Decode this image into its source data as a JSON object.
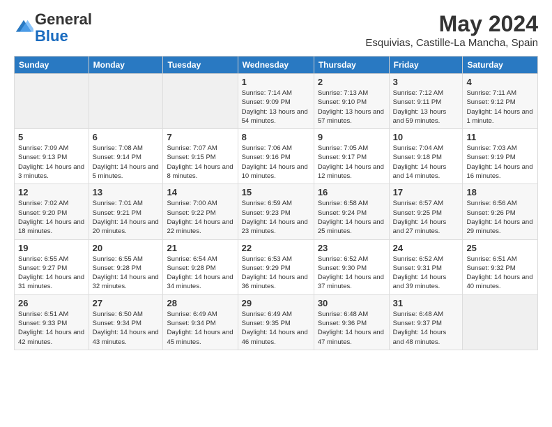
{
  "header": {
    "logo_general": "General",
    "logo_blue": "Blue",
    "title": "May 2024",
    "subtitle": "Esquivias, Castille-La Mancha, Spain"
  },
  "days_of_week": [
    "Sunday",
    "Monday",
    "Tuesday",
    "Wednesday",
    "Thursday",
    "Friday",
    "Saturday"
  ],
  "weeks": [
    [
      {
        "day": "",
        "sunrise": "",
        "sunset": "",
        "daylight": "",
        "empty": true
      },
      {
        "day": "",
        "sunrise": "",
        "sunset": "",
        "daylight": "",
        "empty": true
      },
      {
        "day": "",
        "sunrise": "",
        "sunset": "",
        "daylight": "",
        "empty": true
      },
      {
        "day": "1",
        "sunrise": "Sunrise: 7:14 AM",
        "sunset": "Sunset: 9:09 PM",
        "daylight": "Daylight: 13 hours and 54 minutes."
      },
      {
        "day": "2",
        "sunrise": "Sunrise: 7:13 AM",
        "sunset": "Sunset: 9:10 PM",
        "daylight": "Daylight: 13 hours and 57 minutes."
      },
      {
        "day": "3",
        "sunrise": "Sunrise: 7:12 AM",
        "sunset": "Sunset: 9:11 PM",
        "daylight": "Daylight: 13 hours and 59 minutes."
      },
      {
        "day": "4",
        "sunrise": "Sunrise: 7:11 AM",
        "sunset": "Sunset: 9:12 PM",
        "daylight": "Daylight: 14 hours and 1 minute."
      }
    ],
    [
      {
        "day": "5",
        "sunrise": "Sunrise: 7:09 AM",
        "sunset": "Sunset: 9:13 PM",
        "daylight": "Daylight: 14 hours and 3 minutes."
      },
      {
        "day": "6",
        "sunrise": "Sunrise: 7:08 AM",
        "sunset": "Sunset: 9:14 PM",
        "daylight": "Daylight: 14 hours and 5 minutes."
      },
      {
        "day": "7",
        "sunrise": "Sunrise: 7:07 AM",
        "sunset": "Sunset: 9:15 PM",
        "daylight": "Daylight: 14 hours and 8 minutes."
      },
      {
        "day": "8",
        "sunrise": "Sunrise: 7:06 AM",
        "sunset": "Sunset: 9:16 PM",
        "daylight": "Daylight: 14 hours and 10 minutes."
      },
      {
        "day": "9",
        "sunrise": "Sunrise: 7:05 AM",
        "sunset": "Sunset: 9:17 PM",
        "daylight": "Daylight: 14 hours and 12 minutes."
      },
      {
        "day": "10",
        "sunrise": "Sunrise: 7:04 AM",
        "sunset": "Sunset: 9:18 PM",
        "daylight": "Daylight: 14 hours and 14 minutes."
      },
      {
        "day": "11",
        "sunrise": "Sunrise: 7:03 AM",
        "sunset": "Sunset: 9:19 PM",
        "daylight": "Daylight: 14 hours and 16 minutes."
      }
    ],
    [
      {
        "day": "12",
        "sunrise": "Sunrise: 7:02 AM",
        "sunset": "Sunset: 9:20 PM",
        "daylight": "Daylight: 14 hours and 18 minutes."
      },
      {
        "day": "13",
        "sunrise": "Sunrise: 7:01 AM",
        "sunset": "Sunset: 9:21 PM",
        "daylight": "Daylight: 14 hours and 20 minutes."
      },
      {
        "day": "14",
        "sunrise": "Sunrise: 7:00 AM",
        "sunset": "Sunset: 9:22 PM",
        "daylight": "Daylight: 14 hours and 22 minutes."
      },
      {
        "day": "15",
        "sunrise": "Sunrise: 6:59 AM",
        "sunset": "Sunset: 9:23 PM",
        "daylight": "Daylight: 14 hours and 23 minutes."
      },
      {
        "day": "16",
        "sunrise": "Sunrise: 6:58 AM",
        "sunset": "Sunset: 9:24 PM",
        "daylight": "Daylight: 14 hours and 25 minutes."
      },
      {
        "day": "17",
        "sunrise": "Sunrise: 6:57 AM",
        "sunset": "Sunset: 9:25 PM",
        "daylight": "Daylight: 14 hours and 27 minutes."
      },
      {
        "day": "18",
        "sunrise": "Sunrise: 6:56 AM",
        "sunset": "Sunset: 9:26 PM",
        "daylight": "Daylight: 14 hours and 29 minutes."
      }
    ],
    [
      {
        "day": "19",
        "sunrise": "Sunrise: 6:55 AM",
        "sunset": "Sunset: 9:27 PM",
        "daylight": "Daylight: 14 hours and 31 minutes."
      },
      {
        "day": "20",
        "sunrise": "Sunrise: 6:55 AM",
        "sunset": "Sunset: 9:28 PM",
        "daylight": "Daylight: 14 hours and 32 minutes."
      },
      {
        "day": "21",
        "sunrise": "Sunrise: 6:54 AM",
        "sunset": "Sunset: 9:28 PM",
        "daylight": "Daylight: 14 hours and 34 minutes."
      },
      {
        "day": "22",
        "sunrise": "Sunrise: 6:53 AM",
        "sunset": "Sunset: 9:29 PM",
        "daylight": "Daylight: 14 hours and 36 minutes."
      },
      {
        "day": "23",
        "sunrise": "Sunrise: 6:52 AM",
        "sunset": "Sunset: 9:30 PM",
        "daylight": "Daylight: 14 hours and 37 minutes."
      },
      {
        "day": "24",
        "sunrise": "Sunrise: 6:52 AM",
        "sunset": "Sunset: 9:31 PM",
        "daylight": "Daylight: 14 hours and 39 minutes."
      },
      {
        "day": "25",
        "sunrise": "Sunrise: 6:51 AM",
        "sunset": "Sunset: 9:32 PM",
        "daylight": "Daylight: 14 hours and 40 minutes."
      }
    ],
    [
      {
        "day": "26",
        "sunrise": "Sunrise: 6:51 AM",
        "sunset": "Sunset: 9:33 PM",
        "daylight": "Daylight: 14 hours and 42 minutes."
      },
      {
        "day": "27",
        "sunrise": "Sunrise: 6:50 AM",
        "sunset": "Sunset: 9:34 PM",
        "daylight": "Daylight: 14 hours and 43 minutes."
      },
      {
        "day": "28",
        "sunrise": "Sunrise: 6:49 AM",
        "sunset": "Sunset: 9:34 PM",
        "daylight": "Daylight: 14 hours and 45 minutes."
      },
      {
        "day": "29",
        "sunrise": "Sunrise: 6:49 AM",
        "sunset": "Sunset: 9:35 PM",
        "daylight": "Daylight: 14 hours and 46 minutes."
      },
      {
        "day": "30",
        "sunrise": "Sunrise: 6:48 AM",
        "sunset": "Sunset: 9:36 PM",
        "daylight": "Daylight: 14 hours and 47 minutes."
      },
      {
        "day": "31",
        "sunrise": "Sunrise: 6:48 AM",
        "sunset": "Sunset: 9:37 PM",
        "daylight": "Daylight: 14 hours and 48 minutes."
      },
      {
        "day": "",
        "sunrise": "",
        "sunset": "",
        "daylight": "",
        "empty": true
      }
    ]
  ]
}
